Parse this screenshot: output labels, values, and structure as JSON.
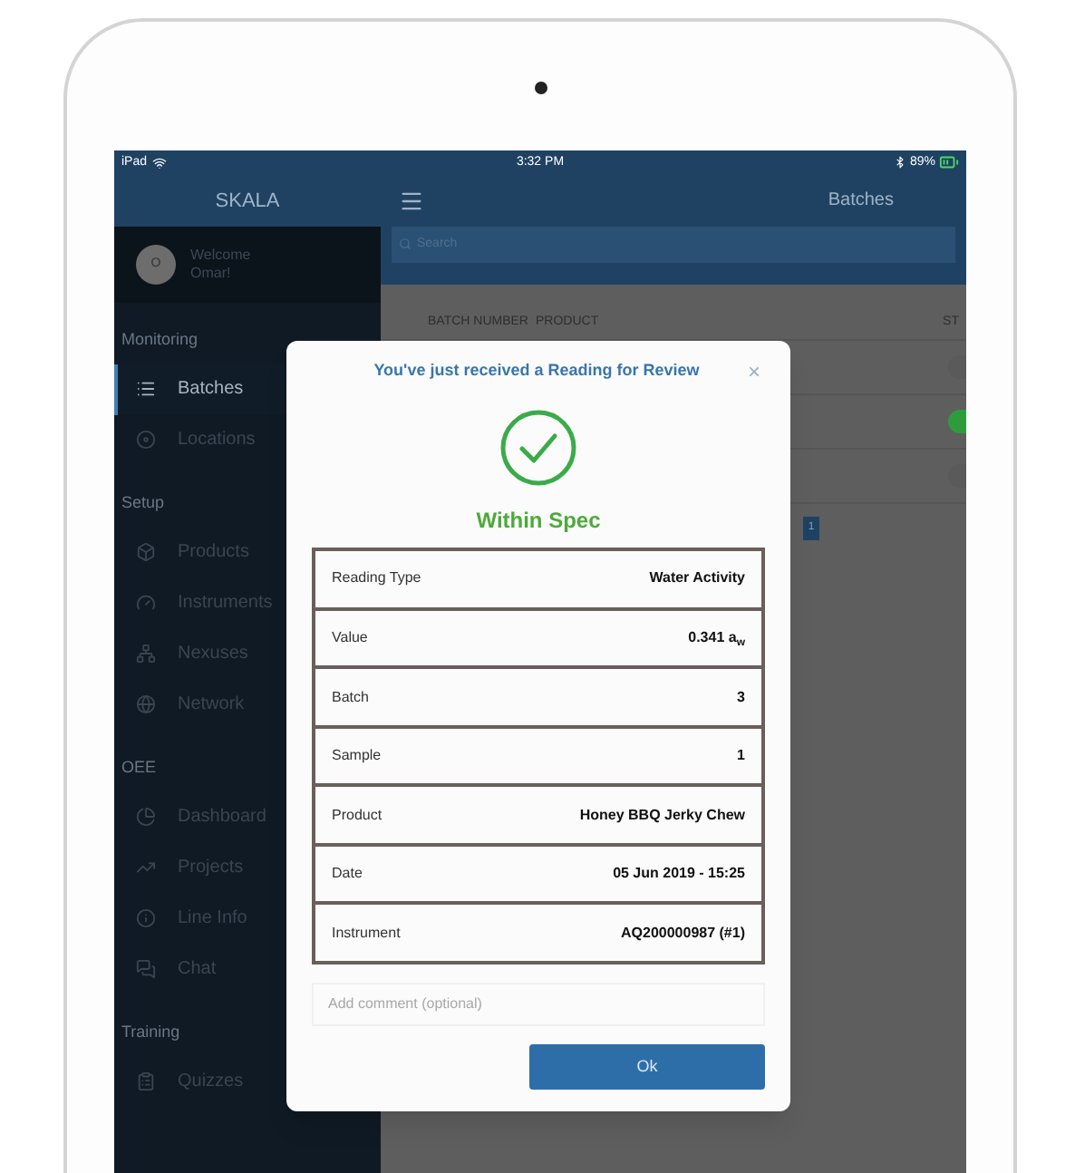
{
  "status_bar": {
    "device": "iPad",
    "time": "3:32 PM",
    "battery": "89%"
  },
  "sidebar": {
    "title": "SKALA",
    "avatar_initial": "O",
    "welcome": "Welcome",
    "user": "Omar!",
    "sections": [
      {
        "heading": "Monitoring",
        "items": [
          {
            "label": "Batches",
            "selected": true
          },
          {
            "label": "Locations",
            "selected": false
          }
        ]
      },
      {
        "heading": "Setup",
        "items": [
          {
            "label": "Products",
            "selected": false
          },
          {
            "label": "Instruments",
            "selected": false
          },
          {
            "label": "Nexuses",
            "selected": false
          },
          {
            "label": "Network",
            "selected": false
          }
        ]
      },
      {
        "heading": "OEE",
        "items": [
          {
            "label": "Dashboard",
            "selected": false
          },
          {
            "label": "Projects",
            "selected": false
          },
          {
            "label": "Line Info",
            "selected": false
          },
          {
            "label": "Chat",
            "selected": false
          }
        ]
      },
      {
        "heading": "Training",
        "items": [
          {
            "label": "Quizzes",
            "selected": false
          }
        ]
      }
    ]
  },
  "header": {
    "title": "Batches"
  },
  "search": {
    "placeholder": "Search"
  },
  "table": {
    "columns": [
      "BATCH NUMBER",
      "PRODUCT",
      "ST"
    ],
    "rows": [
      {
        "color": "#5a5a5a"
      },
      {
        "color": "#2e9c3c"
      },
      {
        "color": "#5a5a5a"
      }
    ]
  },
  "pagination": [
    "1"
  ],
  "dialog": {
    "title": "You've just received a Reading for Review",
    "close": "×",
    "result": "Within Spec",
    "fields": [
      {
        "label": "Reading Type",
        "value": "Water Activity"
      },
      {
        "label": "Value",
        "value": "0.341 a$_{w}$"
      },
      {
        "label": "Batch",
        "value": "3"
      },
      {
        "label": "Sample",
        "value": "1"
      },
      {
        "label": "Product",
        "value": "Honey BBQ Jerky Chew"
      },
      {
        "label": "Date",
        "value": "05 Jun 2019 - 15:25"
      },
      {
        "label": "Instrument",
        "value": "AQ200000987 (#1)"
      }
    ],
    "comment": {
      "placeholder": "Add comment (optional)"
    },
    "ok_button": "Ok"
  }
}
